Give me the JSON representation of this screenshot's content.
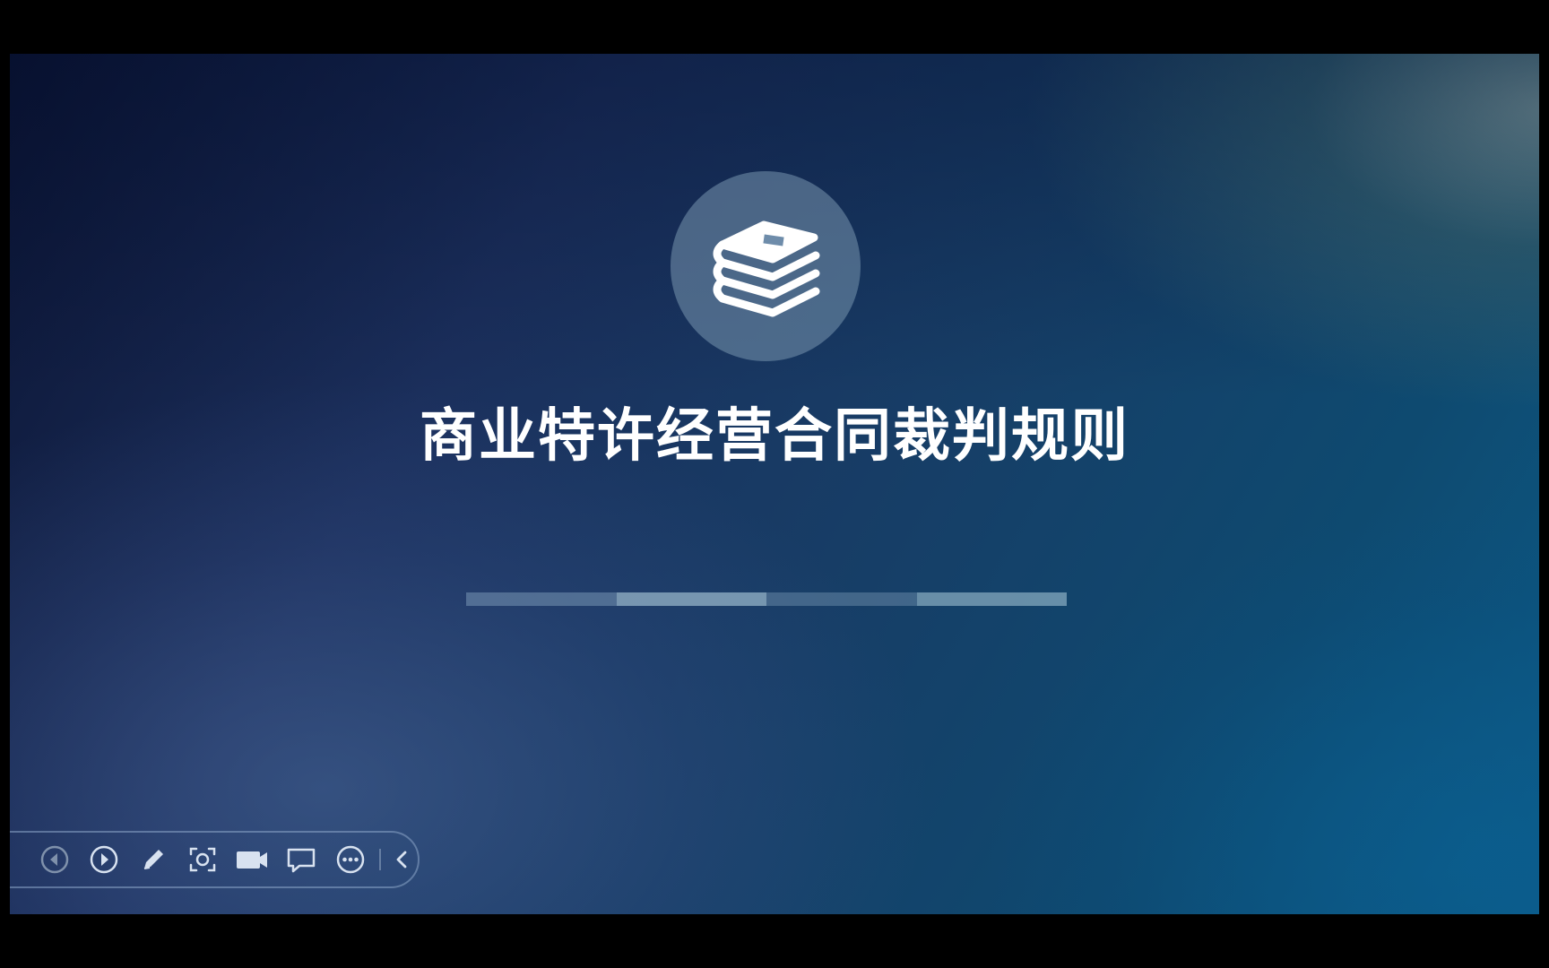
{
  "slide": {
    "title": "商业特许经营合同裁判规则",
    "icon": "books-stack-icon",
    "progress_segments": 4
  },
  "toolbar": {
    "buttons": [
      {
        "name": "previous-slide-button",
        "icon": "prev-arrow-icon",
        "enabled": false
      },
      {
        "name": "next-slide-button",
        "icon": "next-arrow-icon",
        "enabled": true
      },
      {
        "name": "pen-tool-button",
        "icon": "pen-icon",
        "enabled": true
      },
      {
        "name": "screenshot-button",
        "icon": "focus-frame-icon",
        "enabled": true
      },
      {
        "name": "record-video-button",
        "icon": "video-camera-icon",
        "enabled": true
      },
      {
        "name": "comment-button",
        "icon": "comment-icon",
        "enabled": true
      },
      {
        "name": "more-options-button",
        "icon": "more-icon",
        "enabled": true
      },
      {
        "name": "collapse-toolbar-button",
        "icon": "chevron-left-icon",
        "enabled": true
      }
    ]
  },
  "colors": {
    "screen_border": "#000000",
    "title_text": "#ffffff",
    "toolbar_icon": "#d8e2f0",
    "toolbar_icon_disabled": "#7f91ab"
  }
}
